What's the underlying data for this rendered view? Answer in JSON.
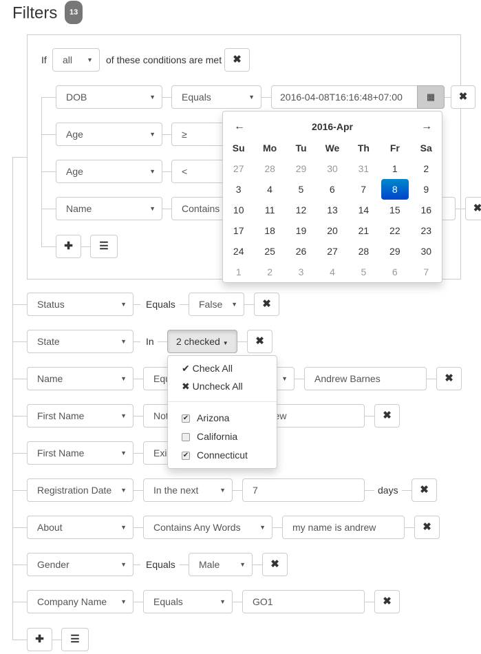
{
  "header": {
    "title": "Filters",
    "count": "13"
  },
  "group": {
    "prefix": "If",
    "match_value": "all",
    "suffix": "of these conditions are met",
    "rows": [
      {
        "field": "DOB",
        "operator": "Equals",
        "value": "2016-04-08T16:16:48+07:00"
      },
      {
        "field": "Age",
        "operator": "≥"
      },
      {
        "field": "Age",
        "operator": "<"
      },
      {
        "field": "Name",
        "operator": "Contains"
      }
    ]
  },
  "datepicker": {
    "month_label": "2016-Apr",
    "prev_icon": "←",
    "next_icon": "→",
    "weekdays": [
      "Su",
      "Mo",
      "Tu",
      "We",
      "Th",
      "Fr",
      "Sa"
    ],
    "weeks": [
      [
        "27",
        "28",
        "29",
        "30",
        "31",
        "1",
        "2"
      ],
      [
        "3",
        "4",
        "5",
        "6",
        "7",
        "8",
        "9"
      ],
      [
        "10",
        "11",
        "12",
        "13",
        "14",
        "15",
        "16"
      ],
      [
        "17",
        "18",
        "19",
        "20",
        "21",
        "22",
        "23"
      ],
      [
        "24",
        "25",
        "26",
        "27",
        "28",
        "29",
        "30"
      ],
      [
        "1",
        "2",
        "3",
        "4",
        "5",
        "6",
        "7"
      ]
    ],
    "selected_day": "8"
  },
  "rules": [
    {
      "field": "Status",
      "operator": "Equals",
      "value": "False"
    },
    {
      "field": "State",
      "operator": "In",
      "value": "2 checked"
    },
    {
      "field": "Name",
      "operator": "Equals",
      "value": "Andrew Barnes"
    },
    {
      "field": "First Name",
      "operator": "Not Equals",
      "value": "Andrew"
    },
    {
      "field": "First Name",
      "operator": "Exists"
    },
    {
      "field": "Registration Date",
      "operator": "In the next",
      "value": "7",
      "unit": "days"
    },
    {
      "field": "About",
      "operator": "Contains Any Words",
      "value": "my name is andrew"
    },
    {
      "field": "Gender",
      "operator": "Equals",
      "value": "Male"
    },
    {
      "field": "Company Name",
      "operator": "Equals",
      "value": "GO1"
    }
  ],
  "state_dropdown": {
    "check_all": "Check All",
    "uncheck_all": "Uncheck All",
    "options": [
      {
        "label": "Arizona",
        "checked": true
      },
      {
        "label": "California",
        "checked": false
      },
      {
        "label": "Connecticut",
        "checked": true
      }
    ]
  },
  "icons": {
    "remove": "✖",
    "add": "✚",
    "list": "☰",
    "calendar": "📅",
    "caret": "▼",
    "check": "✔",
    "cross": "✖"
  }
}
